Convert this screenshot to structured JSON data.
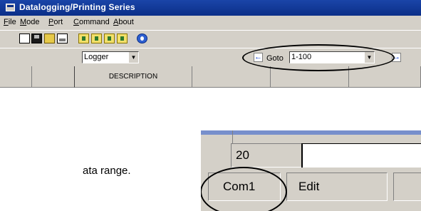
{
  "window": {
    "title": "Datalogging/Printing Series"
  },
  "menu": [
    "File",
    "Mode",
    "Port",
    "Command",
    "About"
  ],
  "toolbar": {
    "icons": [
      "new-icon",
      "save-icon",
      "open-icon",
      "print-icon",
      "first-icon",
      "prev-icon",
      "next-icon",
      "last-icon",
      "help-icon"
    ]
  },
  "mode_select": {
    "value": "Logger"
  },
  "goto": {
    "label": "Goto",
    "value": "1-100"
  },
  "grid": {
    "columns": [
      "",
      "DESCRIPTION",
      "",
      "",
      "",
      ""
    ]
  },
  "body_text": "ata range.",
  "inset": {
    "row_number": "20",
    "status_panes": [
      "Com1",
      "Edit",
      ""
    ]
  }
}
